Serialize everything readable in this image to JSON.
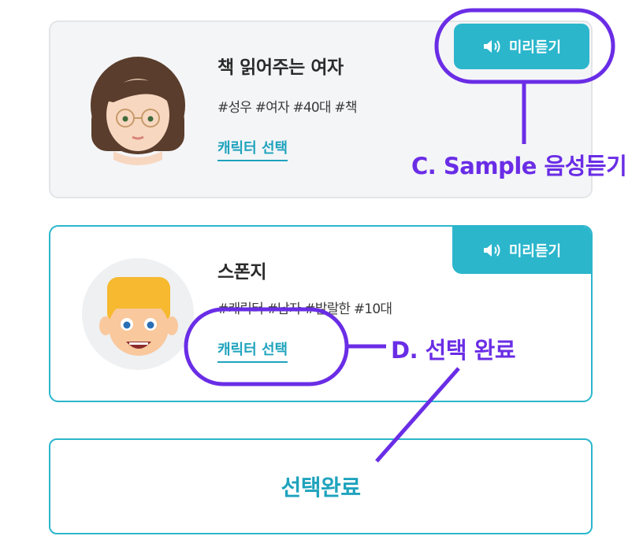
{
  "cards": [
    {
      "name": "책 읽어주는 여자",
      "tags": "#성우 #여자 #40대 #책",
      "select_label": "캐릭터 선택",
      "preview_label": "미리듣기",
      "avatar_icon": "woman-glasses-avatar-icon",
      "state": "default"
    },
    {
      "name": "스폰지",
      "tags": "#캐릭터 #남자 #발랄한 #10대",
      "select_label": "캐릭터 선택",
      "preview_label": "미리듣기",
      "avatar_icon": "boy-cartoon-avatar-icon",
      "state": "selected"
    }
  ],
  "complete_button": {
    "label": "선택완료"
  },
  "annotations": {
    "c": "C. Sample 음성듣기",
    "d": "D. 선택 완료"
  },
  "colors": {
    "accent": "#2bb6cc",
    "link": "#1fa3bd",
    "annotation": "#6a2de6",
    "card_bg": "#f4f5f7"
  }
}
